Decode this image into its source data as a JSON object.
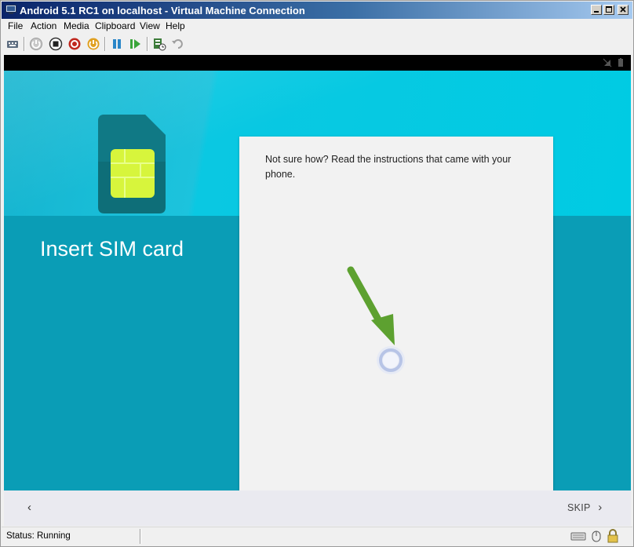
{
  "window": {
    "title": "Android 5.1 RC1 on localhost - Virtual Machine Connection"
  },
  "menu": {
    "items": [
      "File",
      "Action",
      "Media",
      "Clipboard",
      "View",
      "Help"
    ]
  },
  "toolbar": {
    "icons": [
      "ctrl-alt-del-icon",
      "start-icon",
      "turn-off-icon",
      "shutdown-icon",
      "power-icon",
      "pause-icon",
      "resume-icon",
      "checkpoint-icon",
      "revert-icon"
    ]
  },
  "android": {
    "heading": "Insert SIM card",
    "instructions": "Not sure how? Read the instructions that came with your phone.",
    "back_label": "‹",
    "skip_label": "SKIP",
    "skip_chevron": "›"
  },
  "status": {
    "text": "Status: Running"
  },
  "colors": {
    "hero": "#00cbe3",
    "hero_lower": "#0a9db6",
    "card": "#f2f2f2",
    "sim_body": "#0e6e78",
    "sim_chip": "#d7f53c",
    "arrow": "#5da130"
  }
}
